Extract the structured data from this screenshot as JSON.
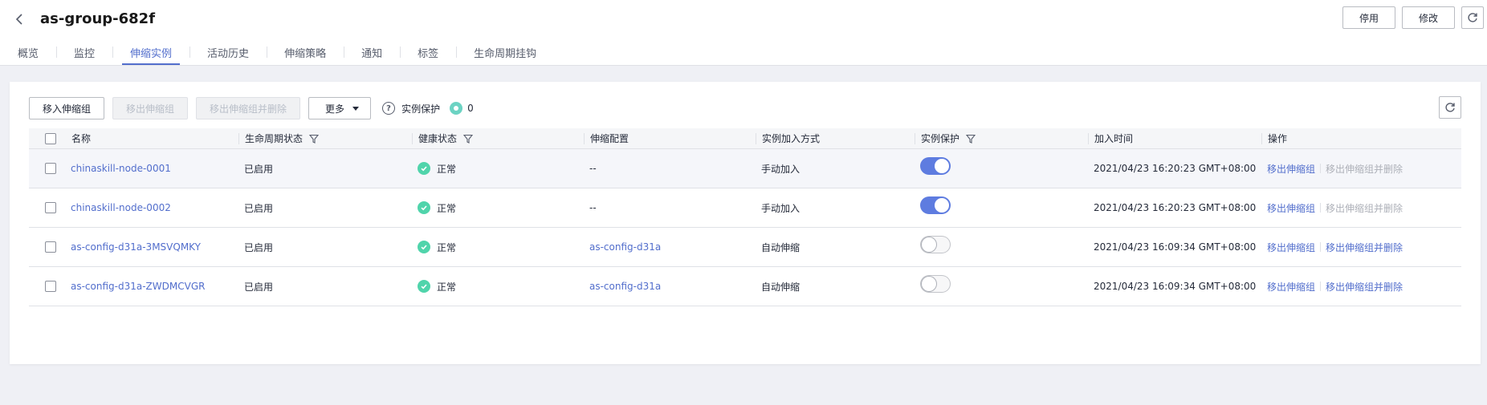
{
  "header": {
    "title": "as-group-682f",
    "buttons": {
      "disable": "停用",
      "modify": "修改"
    }
  },
  "tabs": [
    {
      "label": "概览",
      "active": false
    },
    {
      "label": "监控",
      "active": false
    },
    {
      "label": "伸缩实例",
      "active": true
    },
    {
      "label": "活动历史",
      "active": false
    },
    {
      "label": "伸缩策略",
      "active": false
    },
    {
      "label": "通知",
      "active": false
    },
    {
      "label": "标签",
      "active": false
    },
    {
      "label": "生命周期挂钩",
      "active": false
    }
  ],
  "toolbar": {
    "move_in": "移入伸缩组",
    "move_out": "移出伸缩组",
    "move_out_delete": "移出伸缩组并删除",
    "more": "更多",
    "protect_label": "实例保护",
    "protect_count": "0"
  },
  "table": {
    "columns": [
      "名称",
      "生命周期状态",
      "健康状态",
      "伸缩配置",
      "实例加入方式",
      "实例保护",
      "加入时间",
      "操作"
    ],
    "rows": [
      {
        "name": "chinaskill-node-0001",
        "lifecycle": "已启用",
        "health": "正常",
        "config": "--",
        "config_link": false,
        "join": "手动加入",
        "protect": true,
        "time": "2021/04/23 16:20:23 GMT+08:00",
        "op1": "移出伸缩组",
        "op2": "移出伸缩组并删除",
        "op2_enabled": false
      },
      {
        "name": "chinaskill-node-0002",
        "lifecycle": "已启用",
        "health": "正常",
        "config": "--",
        "config_link": false,
        "join": "手动加入",
        "protect": true,
        "time": "2021/04/23 16:20:23 GMT+08:00",
        "op1": "移出伸缩组",
        "op2": "移出伸缩组并删除",
        "op2_enabled": false
      },
      {
        "name": "as-config-d31a-3MSVQMKY",
        "lifecycle": "已启用",
        "health": "正常",
        "config": "as-config-d31a",
        "config_link": true,
        "join": "自动伸缩",
        "protect": false,
        "time": "2021/04/23 16:09:34 GMT+08:00",
        "op1": "移出伸缩组",
        "op2": "移出伸缩组并删除",
        "op2_enabled": true
      },
      {
        "name": "as-config-d31a-ZWDMCVGR",
        "lifecycle": "已启用",
        "health": "正常",
        "config": "as-config-d31a",
        "config_link": true,
        "join": "自动伸缩",
        "protect": false,
        "time": "2021/04/23 16:09:34 GMT+08:00",
        "op1": "移出伸缩组",
        "op2": "移出伸缩组并删除",
        "op2_enabled": true
      }
    ]
  },
  "colors": {
    "accent": "#526ecc",
    "switch_on": "#5e7ce0",
    "health_ok": "#50d4ab",
    "protect_dot": "#6cd3c3"
  }
}
